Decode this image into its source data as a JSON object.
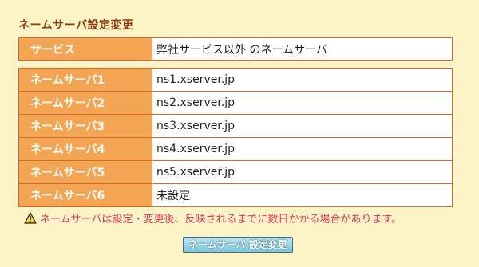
{
  "page": {
    "title": "ネームサーバ設定変更"
  },
  "service": {
    "label": "サービス",
    "value": "弊社サービス以外 のネームサーバ"
  },
  "nameservers": [
    {
      "label": "ネームサーバ1",
      "value": "ns1.xserver.jp"
    },
    {
      "label": "ネームサーバ2",
      "value": "ns2.xserver.jp"
    },
    {
      "label": "ネームサーバ3",
      "value": "ns3.xserver.jp"
    },
    {
      "label": "ネームサーバ4",
      "value": "ns4.xserver.jp"
    },
    {
      "label": "ネームサーバ5",
      "value": "ns5.xserver.jp"
    },
    {
      "label": "ネームサーバ6",
      "value": "未設定"
    }
  ],
  "notice": {
    "icon": "warning-icon",
    "text": "ネームサーバは設定・変更後、反映されるまでに数日かかる場合があります。"
  },
  "submit_button": {
    "label": "ネームサーバ 設定変更"
  },
  "colors": {
    "background": "#fcf3c6",
    "title": "#8b3d10",
    "label_cell": "#f3a553",
    "border": "#d56a2a",
    "notice_text": "#d83b5b",
    "button": "#7cc6df"
  }
}
